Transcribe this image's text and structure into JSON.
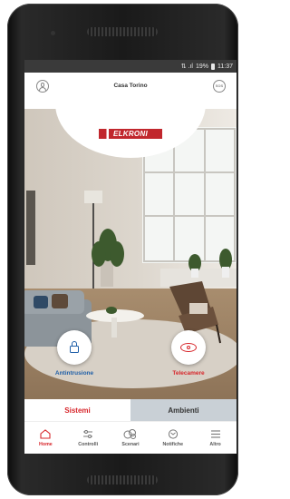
{
  "status_bar": {
    "signal": "⇅ .ıl",
    "battery": "19%",
    "time": "11:37"
  },
  "app_bar": {
    "title": "Casa Torino"
  },
  "brand": {
    "logo_text": "ELKRONI"
  },
  "actions": [
    {
      "label": "Antintrusione",
      "icon": "lock-icon",
      "color": "#1f5fa8"
    },
    {
      "label": "Telecamere",
      "icon": "eye-icon",
      "color": "#d7262b"
    }
  ],
  "tabs": [
    {
      "label": "Sistemi",
      "active": true
    },
    {
      "label": "Ambienti",
      "active": false
    }
  ],
  "bottom_nav": [
    {
      "label": "Home",
      "icon": "home-icon",
      "active": true
    },
    {
      "label": "Controlli",
      "icon": "controls-icon",
      "active": false
    },
    {
      "label": "Scenari",
      "icon": "scenarios-icon",
      "active": false
    },
    {
      "label": "Notifiche",
      "icon": "notifications-icon",
      "active": false
    },
    {
      "label": "Altro",
      "icon": "menu-icon",
      "active": false
    }
  ],
  "colors": {
    "accent": "#d7262b",
    "blue": "#1f5fa8",
    "tab_inactive": "#c9d0d6"
  }
}
